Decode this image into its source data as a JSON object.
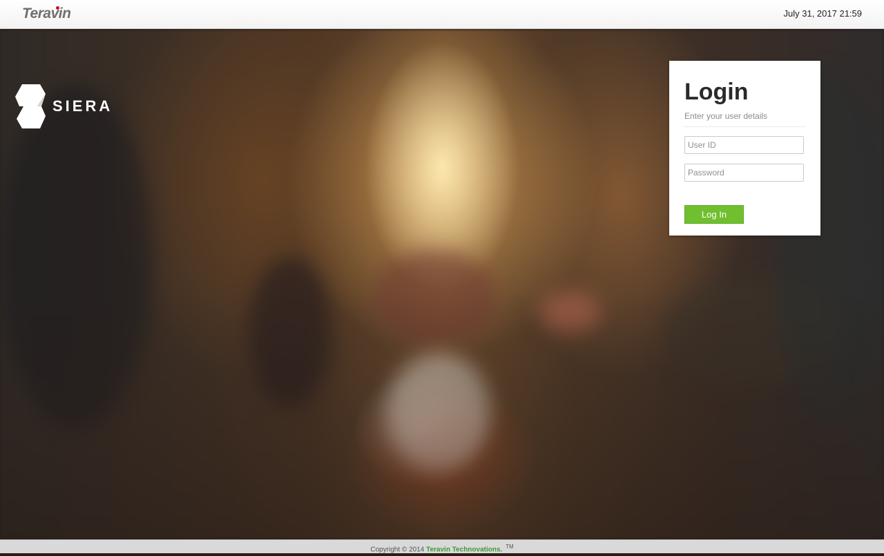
{
  "header": {
    "brand": "Teravin",
    "datetime": "July 31, 2017 21:59"
  },
  "logo": {
    "text": "SIERA"
  },
  "login": {
    "title": "Login",
    "subtitle": "Enter your user details",
    "user_id_placeholder": "User ID",
    "password_placeholder": "Password",
    "submit_label": "Log In"
  },
  "footer": {
    "copyright": "Copyright © 2014",
    "company": "Teravin Technovations.",
    "trademark": "TM"
  },
  "colors": {
    "accent_green": "#6fbf2f",
    "brand_red_dot": "#c8102e",
    "footer_company": "#3e9a36"
  }
}
